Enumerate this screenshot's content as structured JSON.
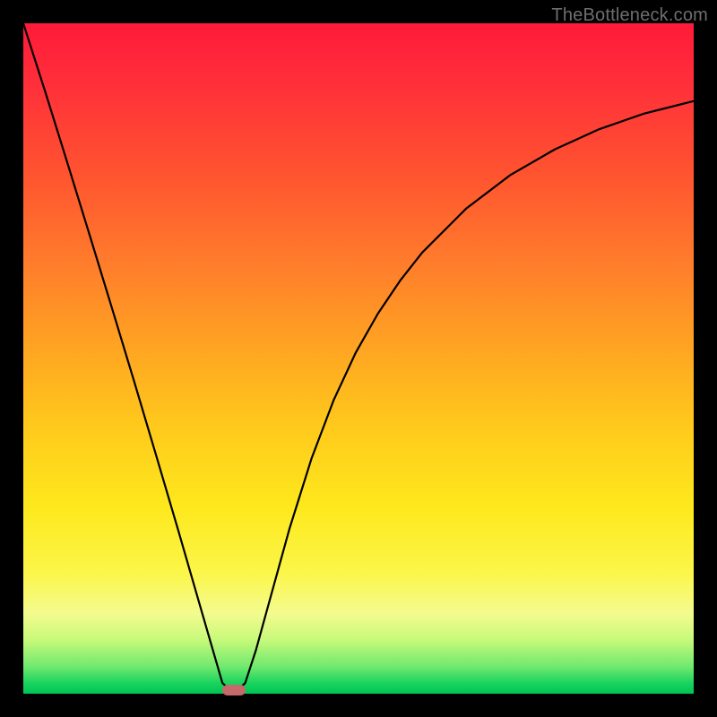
{
  "watermark": "TheBottleneck.com",
  "chart_data": {
    "type": "line",
    "title": "",
    "xlabel": "",
    "ylabel": "",
    "x_range": [
      0,
      1
    ],
    "y_range": [
      0,
      1
    ],
    "series": [
      {
        "name": "bottleneck-curve",
        "x": [
          0.0,
          0.033,
          0.066,
          0.099,
          0.132,
          0.165,
          0.198,
          0.231,
          0.264,
          0.297,
          0.314,
          0.331,
          0.347,
          0.363,
          0.397,
          0.43,
          0.463,
          0.496,
          0.529,
          0.562,
          0.595,
          0.661,
          0.727,
          0.793,
          0.859,
          0.925,
          1.0
        ],
        "y": [
          1.0,
          0.897,
          0.791,
          0.684,
          0.576,
          0.467,
          0.356,
          0.244,
          0.13,
          0.016,
          0.0,
          0.016,
          0.065,
          0.123,
          0.246,
          0.351,
          0.438,
          0.509,
          0.567,
          0.616,
          0.658,
          0.724,
          0.774,
          0.812,
          0.842,
          0.865,
          0.884
        ]
      }
    ],
    "marker": {
      "x": 0.314,
      "y": 0.006
    },
    "background_gradient_stops": [
      {
        "pos": 0.0,
        "color": "#ff1a3a"
      },
      {
        "pos": 0.5,
        "color": "#ffc21c"
      },
      {
        "pos": 0.82,
        "color": "#fbf64a"
      },
      {
        "pos": 1.0,
        "color": "#00c454"
      }
    ]
  }
}
